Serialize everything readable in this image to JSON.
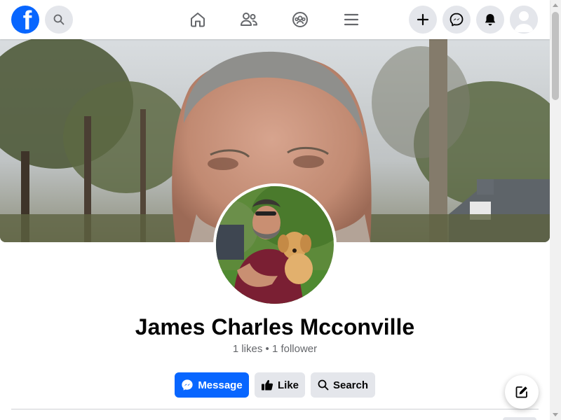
{
  "topbar": {
    "logo_letter": "f",
    "logo_icon": "facebook-logo-icon",
    "search_icon": "search-icon",
    "nav_tabs": [
      {
        "icon": "home-icon",
        "name": "tab-home"
      },
      {
        "icon": "friends-icon",
        "name": "tab-friends"
      },
      {
        "icon": "groups-icon",
        "name": "tab-groups"
      },
      {
        "icon": "menu-icon",
        "name": "tab-menu"
      }
    ],
    "right_buttons": [
      {
        "icon": "plus-icon",
        "name": "create-button"
      },
      {
        "icon": "messenger-icon",
        "name": "messenger-button"
      },
      {
        "icon": "bell-icon",
        "name": "notifications-button"
      }
    ],
    "account_icon": "avatar-icon"
  },
  "profile": {
    "name": "James Charles Mcconville",
    "stats": "1 likes • 1 follower"
  },
  "actions": [
    {
      "label": "Message",
      "icon": "messenger-icon",
      "style": "primary"
    },
    {
      "label": "Like",
      "icon": "thumbs-up-icon",
      "style": "secondary"
    },
    {
      "label": "Search",
      "icon": "search-icon",
      "style": "secondary"
    }
  ],
  "compose_icon": "compose-icon",
  "colors": {
    "brand": "#0866ff",
    "button_grey": "#e4e6eb",
    "text_primary": "#050505",
    "text_secondary": "#65676b"
  }
}
